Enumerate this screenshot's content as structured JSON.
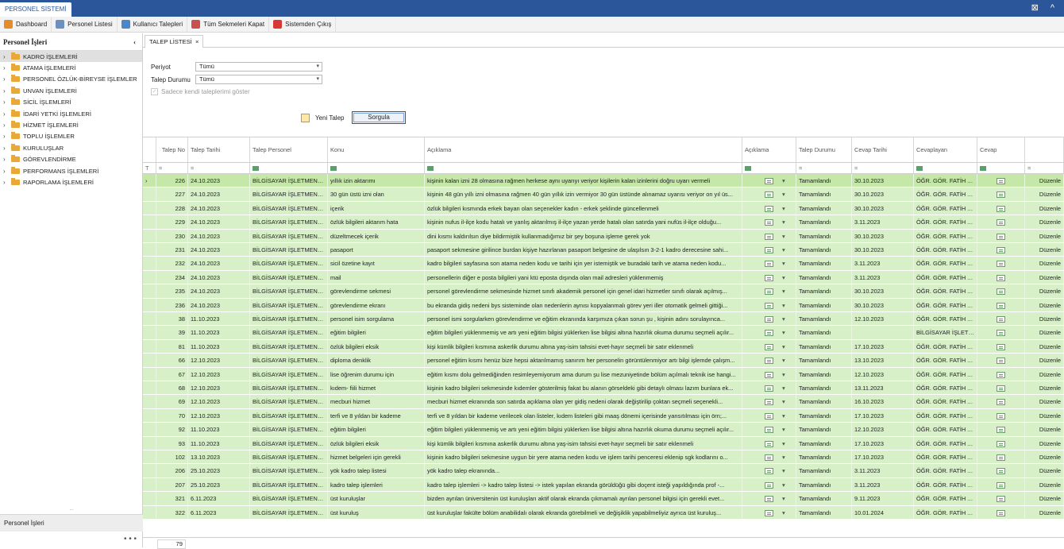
{
  "app": {
    "title": "PERSONEL SİSTEMİ",
    "controls": "⊠ ^"
  },
  "toolbar": {
    "items": [
      {
        "label": "Dashboard",
        "icon": "dashboard-icon",
        "color": "#e58c2a"
      },
      {
        "label": "Personel Listesi",
        "icon": "list-icon",
        "color": "#6e8fbf"
      },
      {
        "label": "Kullanıcı Talepleri",
        "icon": "users-icon",
        "color": "#4b86c8"
      },
      {
        "label": "Tüm Sekmeleri Kapat",
        "icon": "close-tabs-icon",
        "color": "#c85050"
      },
      {
        "label": "Sistemden Çıkış",
        "icon": "exit-icon",
        "color": "#d93636"
      }
    ]
  },
  "sidebar": {
    "title": "Personel İşleri",
    "collapse": "‹",
    "items": [
      "KADRO İŞLEMLERİ",
      "ATAMA İŞLEMLERİ",
      "PERSONEL ÖZLÜK-BİREYSE İŞLEMLER",
      "UNVAN İŞLEMLERİ",
      "SİCİL İŞLEMLERİ",
      "İDARİ YETKİ İŞLEMLERİ",
      "HİZMET İŞLEMLERİ",
      "TOPLU İŞLEMLER",
      "KURULUŞLAR",
      "GÖREVLENDİRME",
      "PERFORMANS İŞLEMLERİ",
      "RAPORLAMA İŞLEMLERİ"
    ],
    "footer": "Personel İşleri",
    "grip": "...",
    "more": "• • •"
  },
  "tab": {
    "label": "TALEP LİSTESİ",
    "close": "×"
  },
  "filters": {
    "period_label": "Periyot",
    "period_value": "Tümü",
    "status_label": "Talep Durumu",
    "status_value": "Tümü",
    "own_only": "Sadece kendi taleplerimi göster"
  },
  "buttons": {
    "new": "Yeni Talep",
    "query": "Sorgula"
  },
  "grid": {
    "columns": [
      "Talep No",
      "Talep Tarihi",
      "Talep Personel",
      "Konu",
      "Açıklama",
      "Açıklama",
      "Talep Durumu",
      "Cevap Tarihi",
      "Cevaplayan",
      "Cevap",
      ""
    ],
    "filter_eq": "=",
    "filter_icon": "ABC",
    "edit_label": "Düzenle",
    "rows": [
      [
        "226",
        "24.10.2023",
        "BİLGİSAYAR İŞLETMENİ ...",
        "yıllık izin aktarımı",
        "kişinin kalan izni 28 olmasına rağmen herkese aynı uyarıyı veriyor kişilerin kalan izinlerini doğru uyarı vermeli",
        "Tamamlandı",
        "30.10.2023",
        "ÖĞR. GÖR. FATİH A..."
      ],
      [
        "227",
        "24.10.2023",
        "BİLGİSAYAR İŞLETMENİ ...",
        "30 gün üstü izni olan",
        "kişinin 48 gün yıllı izni olmasına rağmen 40 gün yıllık izin vermiyor 30 gün üstünde alınamaz uyarısı veriyor on yıl üs...",
        "Tamamlandı",
        "30.10.2023",
        "ÖĞR. GÖR. FATİH A..."
      ],
      [
        "228",
        "24.10.2023",
        "BİLGİSAYAR İŞLETMENİ ...",
        "içerik",
        "özlük bilgileri kısmında erkek bayan olan seçenekler kadın - erkek şeklinde güncellenmeli",
        "Tamamlandı",
        "30.10.2023",
        "ÖĞR. GÖR. FATİH A..."
      ],
      [
        "229",
        "24.10.2023",
        "BİLGİSAYAR İŞLETMENİ ...",
        "özlük bilgileri aktarım hata",
        "kişinin nufus il-ilçe kodu hatalı ve yanlış aktarılmış il-ilçe yazan yerde hatalı olan satırda yani nufüs il-ilçe olduğu...",
        "Tamamlandı",
        "3.11.2023",
        "ÖĞR. GÖR. FATİH A..."
      ],
      [
        "230",
        "24.10.2023",
        "BİLGİSAYAR İŞLETMENİ ...",
        "düzeltmecek içerik",
        "dini kısmı kaldırılsın diye bildirmiştik kullanmadığımız bir şey boşuna işleme gerek yok",
        "Tamamlandı",
        "30.10.2023",
        "ÖĞR. GÖR. FATİH A..."
      ],
      [
        "231",
        "24.10.2023",
        "BİLGİSAYAR İŞLETMENİ ...",
        "pasaport",
        "pasaport sekmesine girilince burdan kişiye hazırlanan pasaport belgesine de ulaşılsın 3-2-1 kadro derecesine sahi...",
        "Tamamlandı",
        "30.10.2023",
        "ÖĞR. GÖR. FATİH A..."
      ],
      [
        "232",
        "24.10.2023",
        "BİLGİSAYAR İŞLETMENİ ...",
        "sicil özetine kayıt",
        "kadro bilgileri sayfasına son atama neden kodu ve tarihi için yer istemiştik ve buradaki tarih ve atama neden kodu...",
        "Tamamlandı",
        "3.11.2023",
        "ÖĞR. GÖR. FATİH A..."
      ],
      [
        "234",
        "24.10.2023",
        "BİLGİSAYAR İŞLETMENİ ...",
        "mail",
        "personellerin diğer e posta bilgileri yani ktü eposta dışında olan mail adresleri yüklenmemiş",
        "Tamamlandı",
        "3.11.2023",
        "ÖĞR. GÖR. FATİH A..."
      ],
      [
        "235",
        "24.10.2023",
        "BİLGİSAYAR İŞLETMENİ ...",
        "görevlendirme sekmesi",
        "personel görevlendirme sekmesinde hizmet sınıfı akademik personel için genel idari hizmetler sınıfı olarak açılmış...",
        "Tamamlandı",
        "30.10.2023",
        "ÖĞR. GÖR. FATİH A..."
      ],
      [
        "236",
        "24.10.2023",
        "BİLGİSAYAR İŞLETMENİ ...",
        "görevlendirme ekranı",
        "bu ekranda gidiş nedeni bys sisteminde olan nedenlerin aynısı kopyalanmalı görev yeri iller otomatik gelmeli gittiği...",
        "Tamamlandı",
        "30.10.2023",
        "ÖĞR. GÖR. FATİH A..."
      ],
      [
        "38",
        "11.10.2023",
        "BİLGİSAYAR İŞLETMENİ ...",
        "personel isim sorgulama",
        "personel ismi sorgularken görevlendirme ve eğitim ekranında karşımıza çıkan sorun şu , kişinin adını sorulayınca...",
        "Tamamlandı",
        "12.10.2023",
        "ÖĞR. GÖR. FATİH A..."
      ],
      [
        "39",
        "11.10.2023",
        "BİLGİSAYAR İŞLETMENİ ...",
        "eğitim bilgileri",
        "eğitim bilgileri yüklenmemiş ve artı yeni eğitim bilgisi yüklerken lise bilgisi altına hazırlık okuma durumu seçmeli açılır...",
        "Tamamlandı",
        "",
        "BİLGİSAYAR İŞLETM..."
      ],
      [
        "81",
        "11.10.2023",
        "BİLGİSAYAR İŞLETMENİ ...",
        "özlük bilgileri eksik",
        "kişi kümlik bilgileri kısmına askerlik durumu altına yaş-isim tahsisi evet-hayır seçmeli bir satır eklenmeli",
        "Tamamlandı",
        "17.10.2023",
        "ÖĞR. GÖR. FATİH A..."
      ],
      [
        "66",
        "12.10.2023",
        "BİLGİSAYAR İŞLETMENİ ...",
        "diploma denklik",
        "personel eğitim kısmı henüz bize hepsi aktarılmamış sanırım her personelin görüntülenmiyor artı bilgi işlemde çalışm...",
        "Tamamlandı",
        "13.10.2023",
        "ÖĞR. GÖR. FATİH A..."
      ],
      [
        "67",
        "12.10.2023",
        "BİLGİSAYAR İŞLETMENİ ...",
        "lise öğrenim durumu için",
        "eğitim kısmı dolu gelmediğinden resimleyemiyorum ama durum şu lise mezuniyetinde bölüm açılmalı teknik ise hangi...",
        "Tamamlandı",
        "12.10.2023",
        "ÖĞR. GÖR. FATİH A..."
      ],
      [
        "68",
        "12.10.2023",
        "BİLGİSAYAR İŞLETMENİ ...",
        "kıdem- fiili hizmet",
        "kişinin kadro bilgileri sekmesinde kıdemler gösterilmiş fakat bu alanın görseldeki gibi detaylı olması lazım bunlara ek...",
        "Tamamlandı",
        "13.11.2023",
        "ÖĞR. GÖR. FATİH A..."
      ],
      [
        "69",
        "12.10.2023",
        "BİLGİSAYAR İŞLETMENİ ...",
        "mecburi hizmet",
        "mecburi hizmet ekranında son satırda açıklama olan yer gidiş nedeni olarak değiştirilip çoktan seçmeli seçenekli...",
        "Tamamlandı",
        "16.10.2023",
        "ÖĞR. GÖR. FATİH A..."
      ],
      [
        "70",
        "12.10.2023",
        "BİLGİSAYAR İŞLETMENİ ...",
        "terfi ve 8 yıldan bir kademe",
        "terfi ve 8 yıldan bir kademe verilecek olan listeler, kıdem listeleri gibi maaş dönemi içerisinde yansıtılması için örn;...",
        "Tamamlandı",
        "17.10.2023",
        "ÖĞR. GÖR. FATİH A..."
      ],
      [
        "92",
        "11.10.2023",
        "BİLGİSAYAR İŞLETMENİ ...",
        "eğitim bilgileri",
        "eğitim bilgileri yüklenmemiş ve artı yeni eğitim bilgisi yüklerken lise bilgisi altına hazırlık okuma durumu seçmeli açılır...",
        "Tamamlandı",
        "12.10.2023",
        "ÖĞR. GÖR. FATİH A..."
      ],
      [
        "93",
        "11.10.2023",
        "BİLGİSAYAR İŞLETMENİ ...",
        "özlük bilgileri eksik",
        "kişi kümlik bilgileri kısmına askerlik durumu altına yaş-isim tahsisi evet-hayır seçmeli bir satır eklenmeli",
        "Tamamlandı",
        "17.10.2023",
        "ÖĞR. GÖR. FATİH A..."
      ],
      [
        "102",
        "13.10.2023",
        "BİLGİSAYAR İŞLETMENİ ...",
        "hizmet belgeleri için gerekli",
        "kişinin kadro bilgileri sekmesine uygun bir yere atama neden kodu ve işlem tarihi penceresi eklenip sgk kodlarını o...",
        "Tamamlandı",
        "17.10.2023",
        "ÖĞR. GÖR. FATİH A..."
      ],
      [
        "206",
        "25.10.2023",
        "BİLGİSAYAR İŞLETMENİ ...",
        "yök kadro talep listesi",
        "yök kadro talep ekranında...",
        "Tamamlandı",
        "3.11.2023",
        "ÖĞR. GÖR. FATİH A..."
      ],
      [
        "207",
        "25.10.2023",
        "BİLGİSAYAR İŞLETMENİ ...",
        "kadro talep işlemleri",
        "kadro talep işlemleri -> kadro talep listesi -> istek yapılan ekranda görüldüğü gibi doçent isteği yapıldığında prof -...",
        "Tamamlandı",
        "3.11.2023",
        "ÖĞR. GÖR. FATİH A..."
      ],
      [
        "321",
        "6.11.2023",
        "BİLGİSAYAR İŞLETMENİ ...",
        "üst kuruluşlar",
        "bizden ayrılan üniversitenin üst kuruluşları aktif olarak ekranda çıkmamalı ayrılan personel bilgisi için gerekli evet...",
        "Tamamlandı",
        "9.11.2023",
        "ÖĞR. GÖR. FATİH A..."
      ],
      [
        "322",
        "6.11.2023",
        "BİLGİSAYAR İŞLETMENİ ...",
        "üst kuruluş",
        "üst kuruluşlar fakülte bölüm anabilidalı olarak ekranda görebilmeli ve değişiklik yapabilmeliyiz ayrıca üst kuruluş...",
        "Tamamlandı",
        "10.01.2024",
        "ÖĞR. GÖR. FATİH A..."
      ]
    ],
    "total": "79"
  },
  "colors": {
    "header": "#2b579a",
    "row": "#d7f0c8",
    "row_selected": "#c5e8a9"
  }
}
